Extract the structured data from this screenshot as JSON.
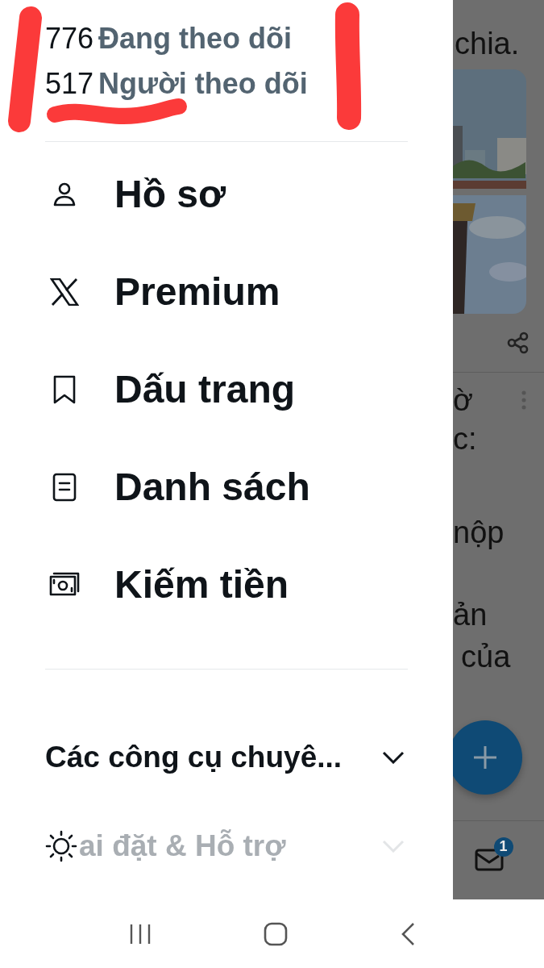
{
  "stats": [
    {
      "count": "776",
      "label": "Đang theo dõi"
    },
    {
      "count": "517",
      "label": "Người theo dõi"
    }
  ],
  "menu": [
    {
      "kind": "person",
      "label": "Hồ sơ"
    },
    {
      "kind": "x",
      "label": "Premium"
    },
    {
      "kind": "bookmark",
      "label": "Dấu trang"
    },
    {
      "kind": "list",
      "label": "Danh sách"
    },
    {
      "kind": "money",
      "label": "Kiếm tiền"
    }
  ],
  "sections": [
    {
      "label": "Các công cụ chuyê...",
      "faded": false,
      "expanded": false
    },
    {
      "label": "ai đặt & Hỗ trợ",
      "faded": true,
      "expanded": false
    }
  ],
  "feed": {
    "top_lines": [
      "chia."
    ],
    "post_lines": [
      "ờ",
      "c:"
    ],
    "body_lines": [
      "nộp",
      "ản",
      "của"
    ],
    "mail_badge": "1"
  }
}
